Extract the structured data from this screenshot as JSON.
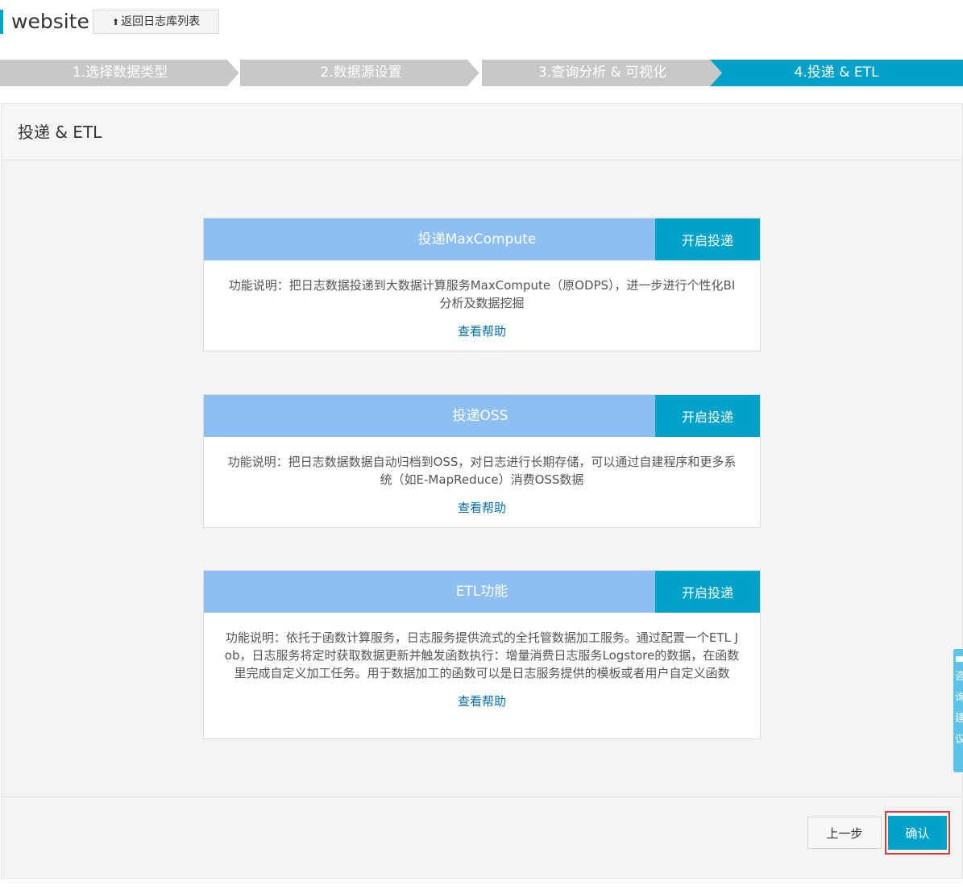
{
  "header": {
    "title": "website",
    "back_label": "返回日志库列表"
  },
  "steps": [
    {
      "label": "1.选择数据类型",
      "active": false
    },
    {
      "label": "2.数据源设置",
      "active": false
    },
    {
      "label": "3.查询分析 & 可视化",
      "active": false
    },
    {
      "label": "4.投递 & ETL",
      "active": true
    }
  ],
  "panel": {
    "title": "投递 & ETL"
  },
  "cards": [
    {
      "title": "投递MaxCompute",
      "action": "开启投递",
      "description": "功能说明：把日志数据投递到大数据计算服务MaxCompute（原ODPS），进一步进行个性化BI分析及数据挖掘",
      "help": "查看帮助"
    },
    {
      "title": "投递OSS",
      "action": "开启投递",
      "description": "功能说明：把日志数据数据自动归档到OSS，对日志进行长期存储，可以通过自建程序和更多系统（如E-MapReduce）消费OSS数据",
      "help": "查看帮助"
    },
    {
      "title": "ETL功能",
      "action": "开启投递",
      "description": "功能说明：依托于函数计算服务，日志服务提供流式的全托管数据加工服务。通过配置一个ETL Job，日志服务将定时获取数据更新并触发函数执行：增量消费日志服务Logstore的数据，在函数里完成自定义加工任务。用于数据加工的函数可以是日志服务提供的模板或者用户自定义函数",
      "help": "查看帮助"
    }
  ],
  "footer": {
    "prev_label": "上一步",
    "confirm_label": "确认"
  },
  "float_tab": {
    "text": "咨询建议"
  },
  "colors": {
    "accent": "#00a2ca",
    "card_header": "#8dbff2",
    "step_inactive": "#c8c8c8",
    "link": "#0070b8",
    "highlight_outline": "#d63a3a"
  }
}
